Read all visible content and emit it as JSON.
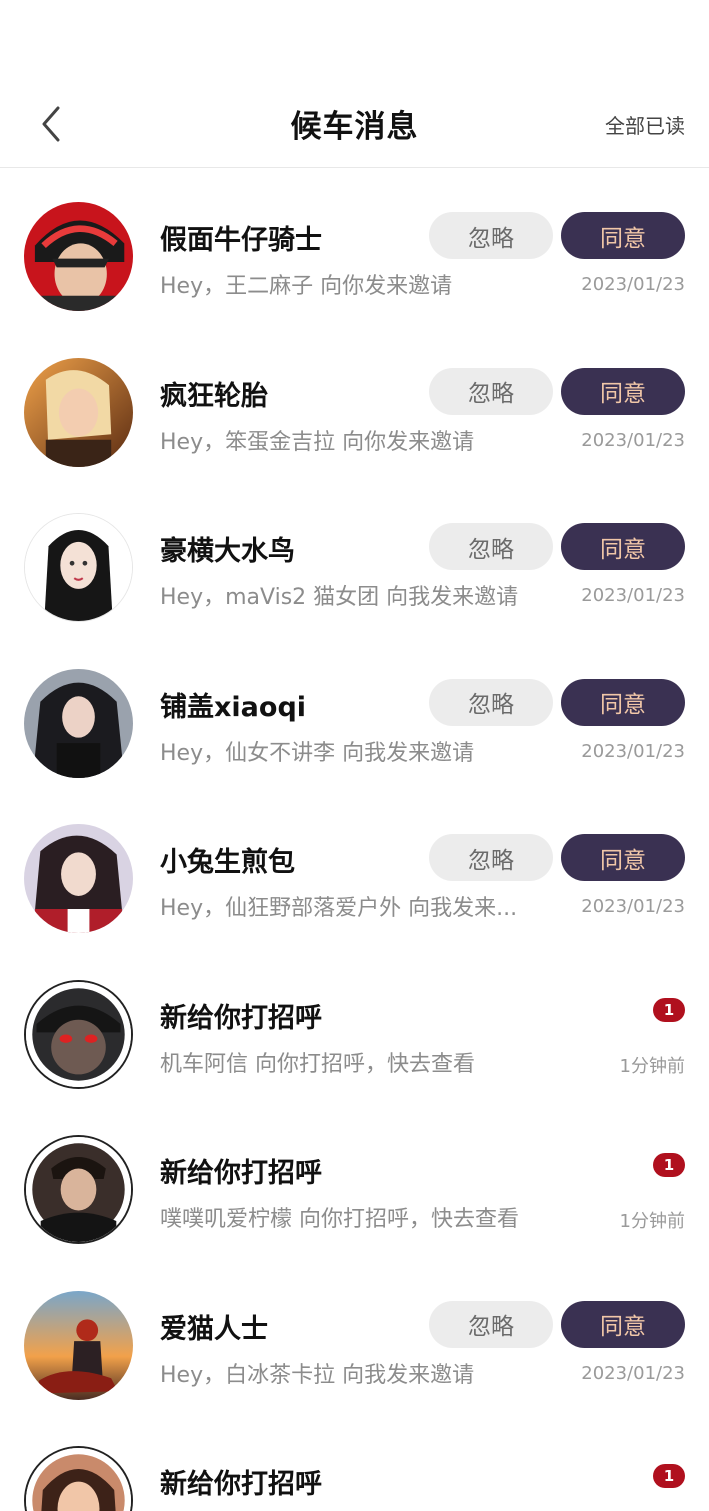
{
  "nav": {
    "title": "候车消息",
    "action_label": "全部已读"
  },
  "ignore_label": "忽略",
  "agree_label": "同意",
  "messages": [
    {
      "type": "invite",
      "name": "假面牛仔骑士",
      "subtitle": "Hey，王二麻子 向你发来邀请",
      "time": "2023/01/23",
      "avatar": "avatar-helmet-red"
    },
    {
      "type": "invite",
      "name": "疯狂轮胎",
      "subtitle": "Hey，笨蛋金吉拉 向你发来邀请",
      "time": "2023/01/23",
      "avatar": "avatar-blonde-sunset"
    },
    {
      "type": "invite",
      "name": "豪横大水鸟",
      "subtitle": "Hey，maVis2 猫女团 向我发来邀请",
      "time": "2023/01/23",
      "avatar": "avatar-dark-hair-white-bg"
    },
    {
      "type": "invite",
      "name": "铺盖xiaoqi",
      "subtitle": "Hey，仙女不讲李 向我发来邀请",
      "time": "2023/01/23",
      "avatar": "avatar-curly-black-hair"
    },
    {
      "type": "invite",
      "name": "小兔生煎包",
      "subtitle": "Hey，仙狂野部落爱户外 向我发来...",
      "time": "2023/01/23",
      "avatar": "avatar-biker-girl"
    },
    {
      "type": "greeting",
      "name": "新给你打招呼",
      "subtitle": "机车阿信 向你打招呼，快去查看",
      "time": "1分钟前",
      "badge": "1",
      "avatar": "avatar-masked-rider"
    },
    {
      "type": "greeting",
      "name": "新给你打招呼",
      "subtitle": "噗噗叽爱柠檬 向你打招呼，快去查看",
      "time": "1分钟前",
      "badge": "1",
      "avatar": "avatar-leather-jacket-man"
    },
    {
      "type": "invite",
      "name": "爱猫人士",
      "subtitle": "Hey，白冰茶卡拉 向我发来邀请",
      "time": "2023/01/23",
      "avatar": "avatar-motorcycle-sunset"
    },
    {
      "type": "greeting",
      "name": "新给你打招呼",
      "subtitle": "",
      "time": "",
      "badge": "1",
      "avatar": "avatar-smiling-woman"
    }
  ],
  "colors": {
    "agree_bg": "#3a3152",
    "agree_text": "#f1c7a8",
    "ignore_bg": "#ececec",
    "badge": "#b0101e"
  }
}
